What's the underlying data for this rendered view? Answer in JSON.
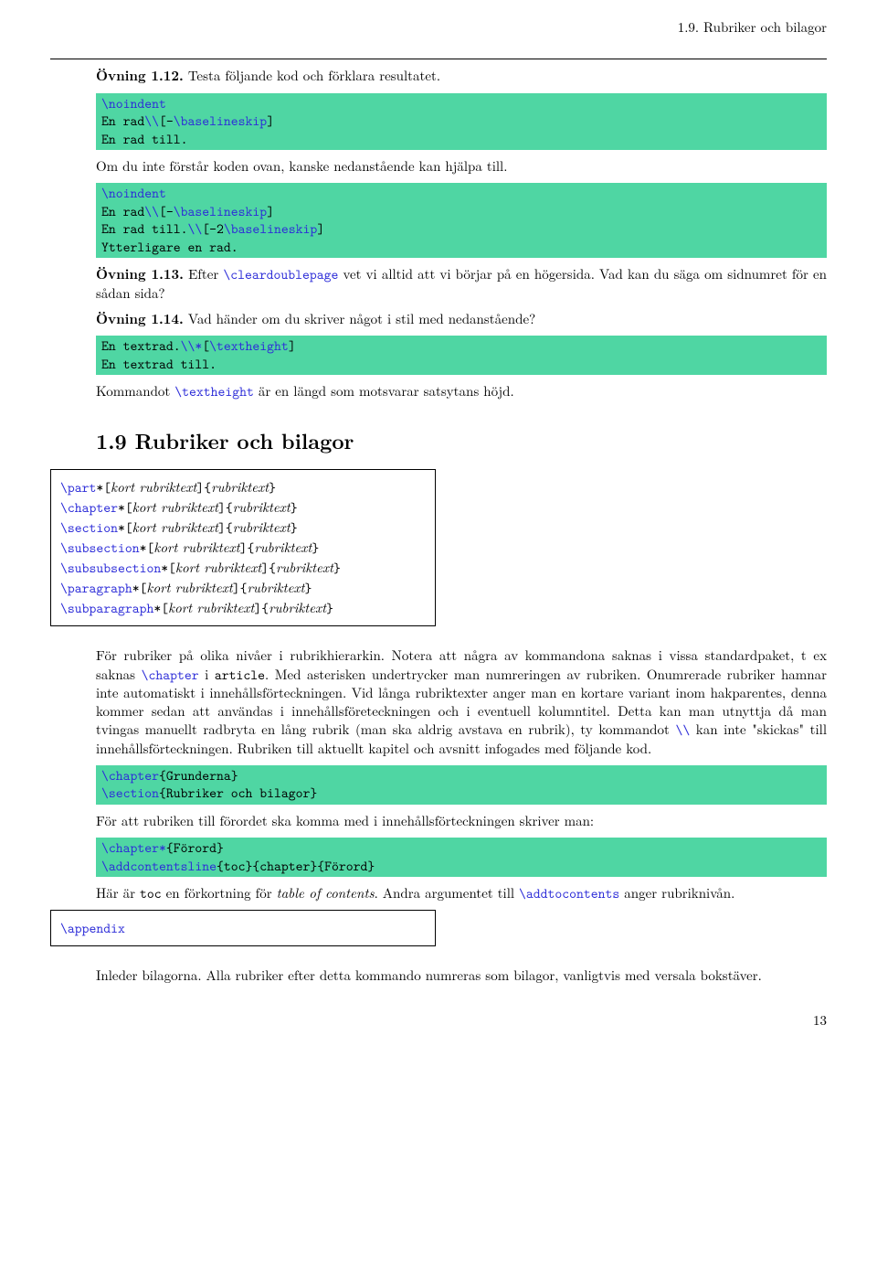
{
  "runningHead": "1.9. Rubriker och bilagor",
  "ex112": {
    "label": "Övning 1.12.",
    "text": " Testa följande kod och förklara resultatet."
  },
  "code1": {
    "l1a": "\\noindent",
    "l1b": "",
    "l2a": "En rad",
    "l2b": "\\\\",
    "l2c": "[-",
    "l2d": "\\baselineskip",
    "l2e": "]",
    "l3": "En rad till."
  },
  "para1": "Om du inte förstår koden ovan, kanske nedanstående kan hjälpa till.",
  "code2": {
    "l1a": "\\noindent",
    "l2a": "En rad",
    "l2b": "\\\\",
    "l2c": "[-",
    "l2d": "\\baselineskip",
    "l2e": "]",
    "l3a": "En rad till.",
    "l3b": "\\\\",
    "l3c": "[-2",
    "l3d": "\\baselineskip",
    "l3e": "]",
    "l4": "Ytterligare en rad."
  },
  "ex113": {
    "label": "Övning 1.13.",
    "t1": " Efter ",
    "cmd": "\\cleardoublepage",
    "t2": " vet vi alltid att vi börjar på en högersida. Vad kan du säga om sidnumret för en sådan sida?"
  },
  "ex114": {
    "label": "Övning 1.14.",
    "text": " Vad händer om du skriver något i stil med nedanstående?"
  },
  "code3": {
    "l1a": "En textrad.",
    "l1b": "\\\\*",
    "l1c": "[",
    "l1d": "\\textheight",
    "l1e": "]",
    "l2": "En textrad till."
  },
  "para2a": "Kommandot ",
  "para2cmd": "\\textheight",
  "para2b": " är en längd som motsvarar satsytans höjd.",
  "sectionTitle": "1.9   Rubriker och bilagor",
  "syntax": {
    "rows": [
      {
        "cmd": "\\part",
        "star": "*",
        "opt": "kort rubriktext",
        "arg": "rubriktext"
      },
      {
        "cmd": "\\chapter",
        "star": "*",
        "opt": "kort rubriktext",
        "arg": "rubriktext"
      },
      {
        "cmd": "\\section",
        "star": "*",
        "opt": "kort rubriktext",
        "arg": "rubriktext"
      },
      {
        "cmd": "\\subsection",
        "star": "*",
        "opt": "kort rubriktext",
        "arg": "rubriktext"
      },
      {
        "cmd": "\\subsubsection",
        "star": "*",
        "opt": "kort rubriktext",
        "arg": "rubriktext"
      },
      {
        "cmd": "\\paragraph",
        "star": "*",
        "opt": "kort rubriktext",
        "arg": "rubriktext"
      },
      {
        "cmd": "\\subparagraph",
        "star": "*",
        "opt": "kort rubriktext",
        "arg": "rubriktext"
      }
    ]
  },
  "body1a": "För rubriker på olika nivåer i rubrikhierarkin. Notera att några av kommandona saknas i vissa standardpaket, t ex saknas ",
  "body1cmd1": "\\chapter",
  "body1b": " i ",
  "body1tt": "article",
  "body1c": ". Med asterisken undertrycker man numreringen av rubriken. Onumrerade rubriker hamnar inte automatiskt i innehållsförteckningen. Vid långa rubriktexter anger man en kortare variant inom hakparentes, denna kommer sedan att användas i innehållsföreteckningen och i eventuell kolumntitel. Detta kan man utnyttja då man tvingas manuellt radbryta en lång rubrik (man ska aldrig avstava en rubrik), ty kommandot ",
  "body1cmd2": "\\\\",
  "body1d": " kan inte \"skickas\" till innehållsförteckningen. Rubriken till aktuellt kapitel och avsnitt infogades med följande kod.",
  "code4": {
    "l1a": "\\chapter",
    "l1b": "{Grunderna}",
    "l2a": "\\section",
    "l2b": "{Rubriker och bilagor}"
  },
  "body2": "För att rubriken till förordet ska komma med i innehållsförteckningen skriver man:",
  "code5": {
    "l1a": "\\chapter*",
    "l1b": "{Förord}",
    "l2a": "\\addcontentsline",
    "l2b": "{toc}{chapter}{Förord}"
  },
  "body3a": "Här är ",
  "body3tt": "toc",
  "body3b": " en förkortning för ",
  "body3it": "table of contents",
  "body3c": ". Andra argumentet till ",
  "body3cmd": "\\addtocontents",
  "body3d": " anger rubriknivån.",
  "appendixCmd": "\\appendix",
  "body4": "Inleder bilagorna. Alla rubriker efter detta kommando numreras som bilagor, vanligtvis med versala bokstäver.",
  "pageNum": "13"
}
